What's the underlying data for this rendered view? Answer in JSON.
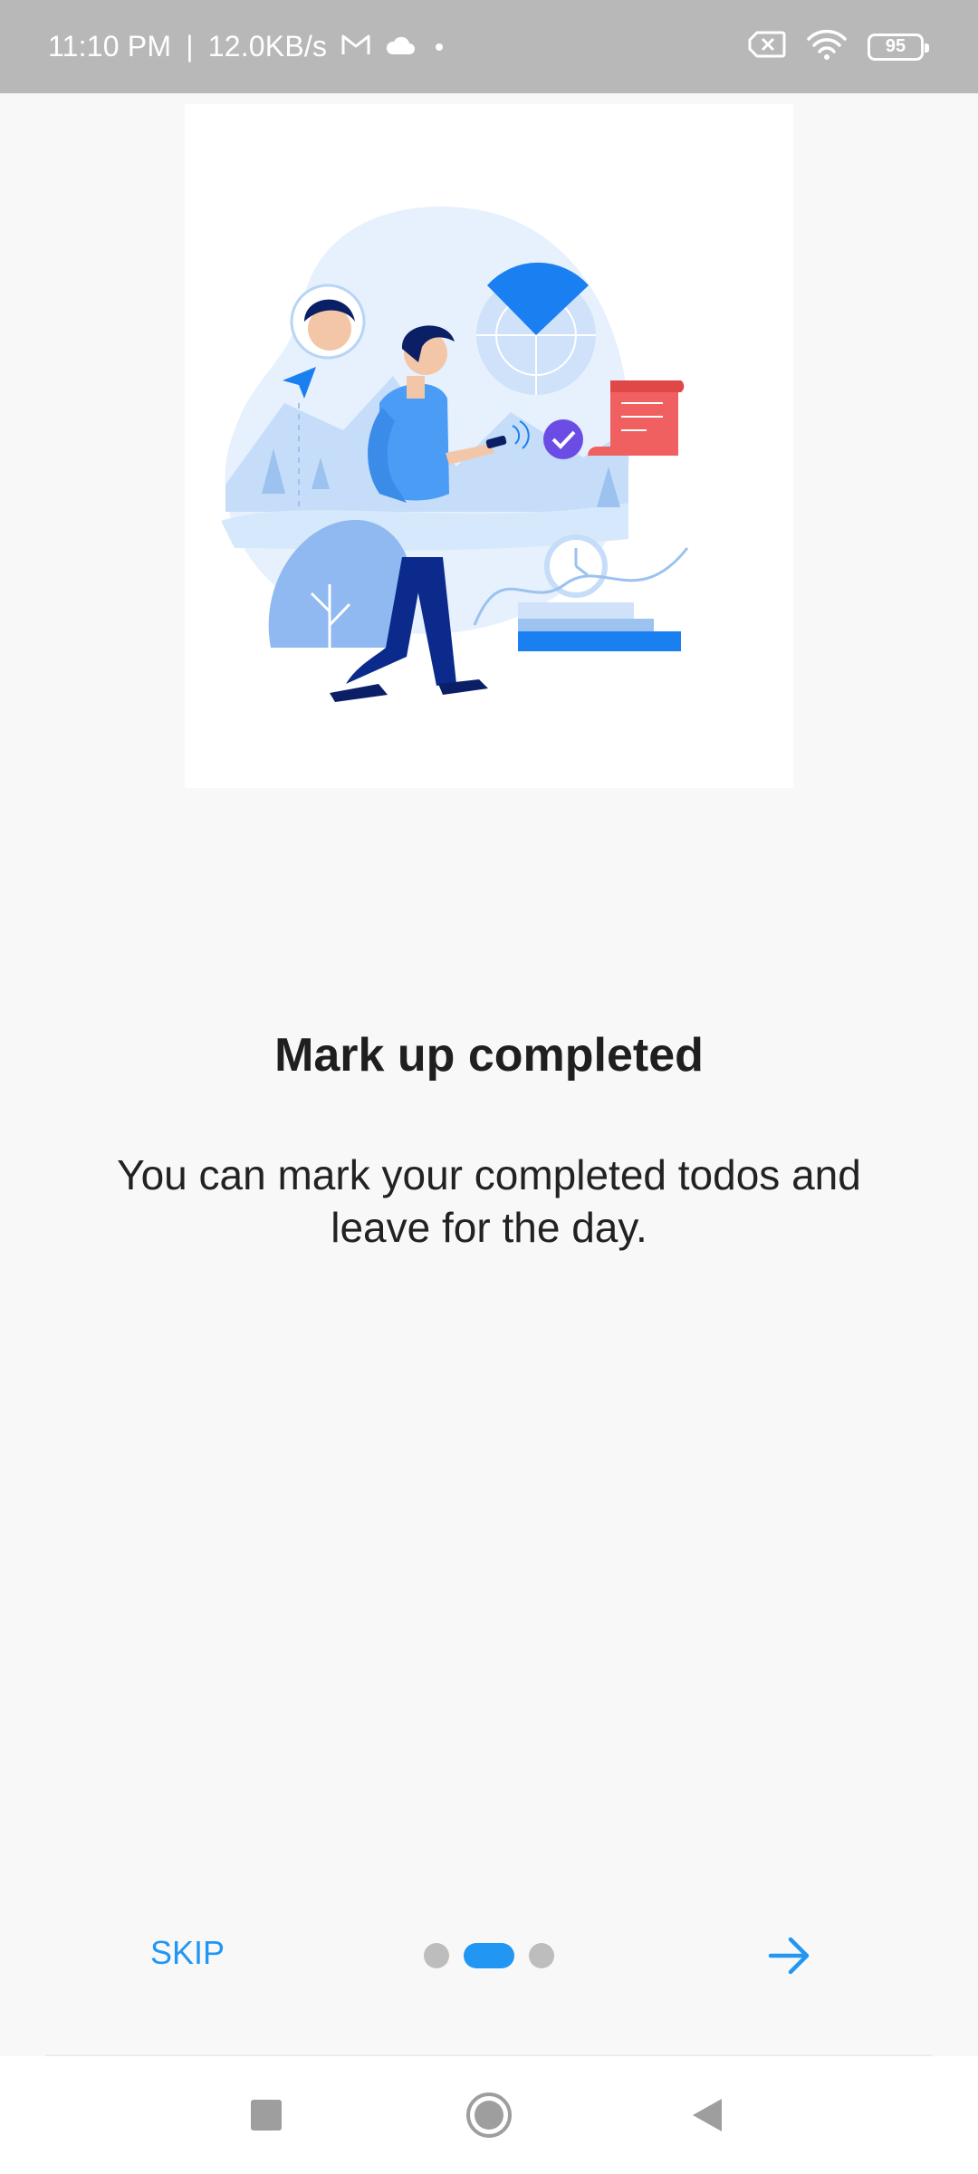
{
  "status_bar": {
    "time": "11:10 PM",
    "separator": "|",
    "network_speed": "12.0KB/s",
    "battery_level": "95",
    "icons": [
      "gmail-icon",
      "cloud-icon",
      "dot-icon",
      "no-sim-icon",
      "wifi-icon",
      "battery-icon"
    ]
  },
  "onboarding": {
    "illustration": "man-walking-with-phone-illustration",
    "title": "Mark up completed",
    "description": "You can mark your completed todos and leave for the day.",
    "skip_label": "SKIP",
    "page_count": 3,
    "current_page": 2,
    "next_icon": "arrow-right-icon"
  },
  "nav_bar": {
    "icons": [
      "recents-square-icon",
      "home-circle-icon",
      "back-triangle-icon"
    ]
  },
  "colors": {
    "accent": "#2196f3",
    "status_bar_bg": "#b8b8b8",
    "background": "#f8f8f8",
    "inactive_dot": "#bdbdbd"
  }
}
